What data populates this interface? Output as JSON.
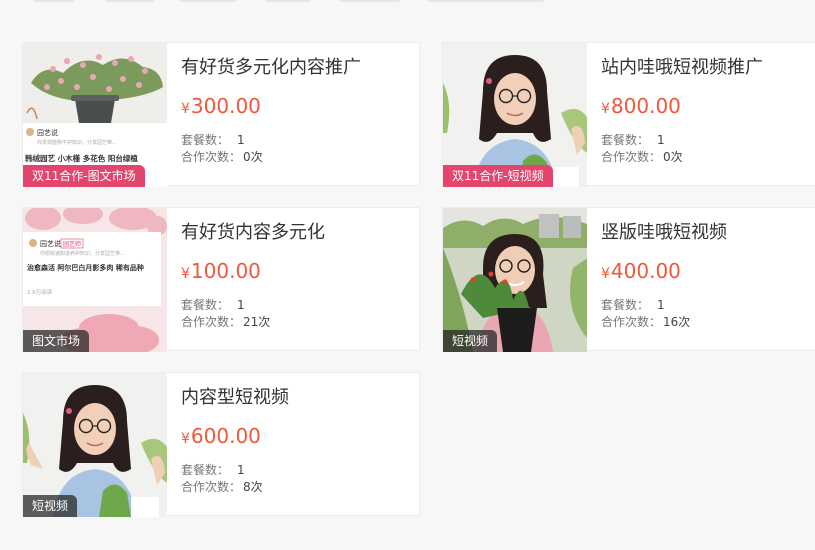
{
  "cards": [
    {
      "title": "有好货多元化内容推广",
      "price_symbol": "¥",
      "price": "300.00",
      "package_label": "套餐数：",
      "package_value": "1",
      "coop_label": "合作次数：",
      "coop_value": "0次",
      "tag": "双11合作-图文市场"
    },
    {
      "title": "站内哇哦短视频推广",
      "price_symbol": "¥",
      "price": "800.00",
      "package_label": "套餐数：",
      "package_value": "1",
      "coop_label": "合作次数：",
      "coop_value": "0次",
      "tag": "双11合作-短视频"
    },
    {
      "title": "有好货内容多元化",
      "price_symbol": "¥",
      "price": "100.00",
      "package_label": "套餐数：",
      "package_value": "1",
      "coop_label": "合作次数：",
      "coop_value": "21次",
      "tag": "图文市场"
    },
    {
      "title": "竖版哇哦短视频",
      "price_symbol": "¥",
      "price": "400.00",
      "package_label": "套餐数：",
      "package_value": "1",
      "coop_label": "合作次数：",
      "coop_value": "16次",
      "tag": "短视频"
    },
    {
      "title": "内容型短视频",
      "price_symbol": "¥",
      "price": "600.00",
      "package_label": "套餐数：",
      "package_value": "1",
      "coop_label": "合作次数：",
      "coop_value": "8次",
      "tag": "短视频"
    }
  ],
  "thumb_text": {
    "card1": {
      "account": "园艺说",
      "desc": "你发现植物不护知识，分享园艺带...",
      "caption": "韩绒园艺 小木槿 多花色 阳台绿植"
    },
    "card3": {
      "account": "园艺说",
      "badge": "园艺师",
      "desc": "你想快速知道养护知识，分享园艺带...",
      "caption": "治愈森活 阿尔巴白月影多肉 稀有品种",
      "views": "2.6万阅读"
    }
  },
  "colors": {
    "price": "#f2573c",
    "tag_pink": "#e4456e",
    "tag_dark": "#3a3a3a"
  }
}
